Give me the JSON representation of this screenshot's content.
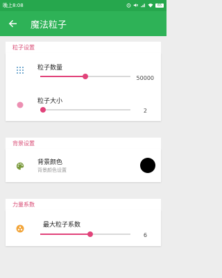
{
  "status_bar": {
    "time": "晚上8:08",
    "battery": "65"
  },
  "app_bar": {
    "title": "魔法粒子"
  },
  "sections": {
    "particle": {
      "header": "粒子设置",
      "count": {
        "label": "粒子数量",
        "value": "50000",
        "fraction": 0.5
      },
      "size": {
        "label": "粒子大小",
        "value": "2",
        "fraction": 0.03
      }
    },
    "background": {
      "header": "背景设置",
      "color": {
        "label": "背景颜色",
        "subtitle": "背景颜色设置",
        "swatch": "#000000"
      }
    },
    "force": {
      "header": "力量系数",
      "max": {
        "label": "最大粒子系数",
        "value": "6",
        "fraction": 0.55
      }
    }
  },
  "colors": {
    "primary": "#2eb257",
    "status": "#26a74d",
    "accent": "#e1437a",
    "section_header": "#d84b74",
    "icon_blue": "#4a90c2",
    "icon_pink": "#ec8fb2",
    "icon_orange": "#f2a53a"
  },
  "icons": {
    "back": "arrow-left-icon",
    "count": "dot-grid-icon",
    "size": "circle-icon",
    "color": "palette-icon",
    "force": "particle-cluster-icon"
  }
}
